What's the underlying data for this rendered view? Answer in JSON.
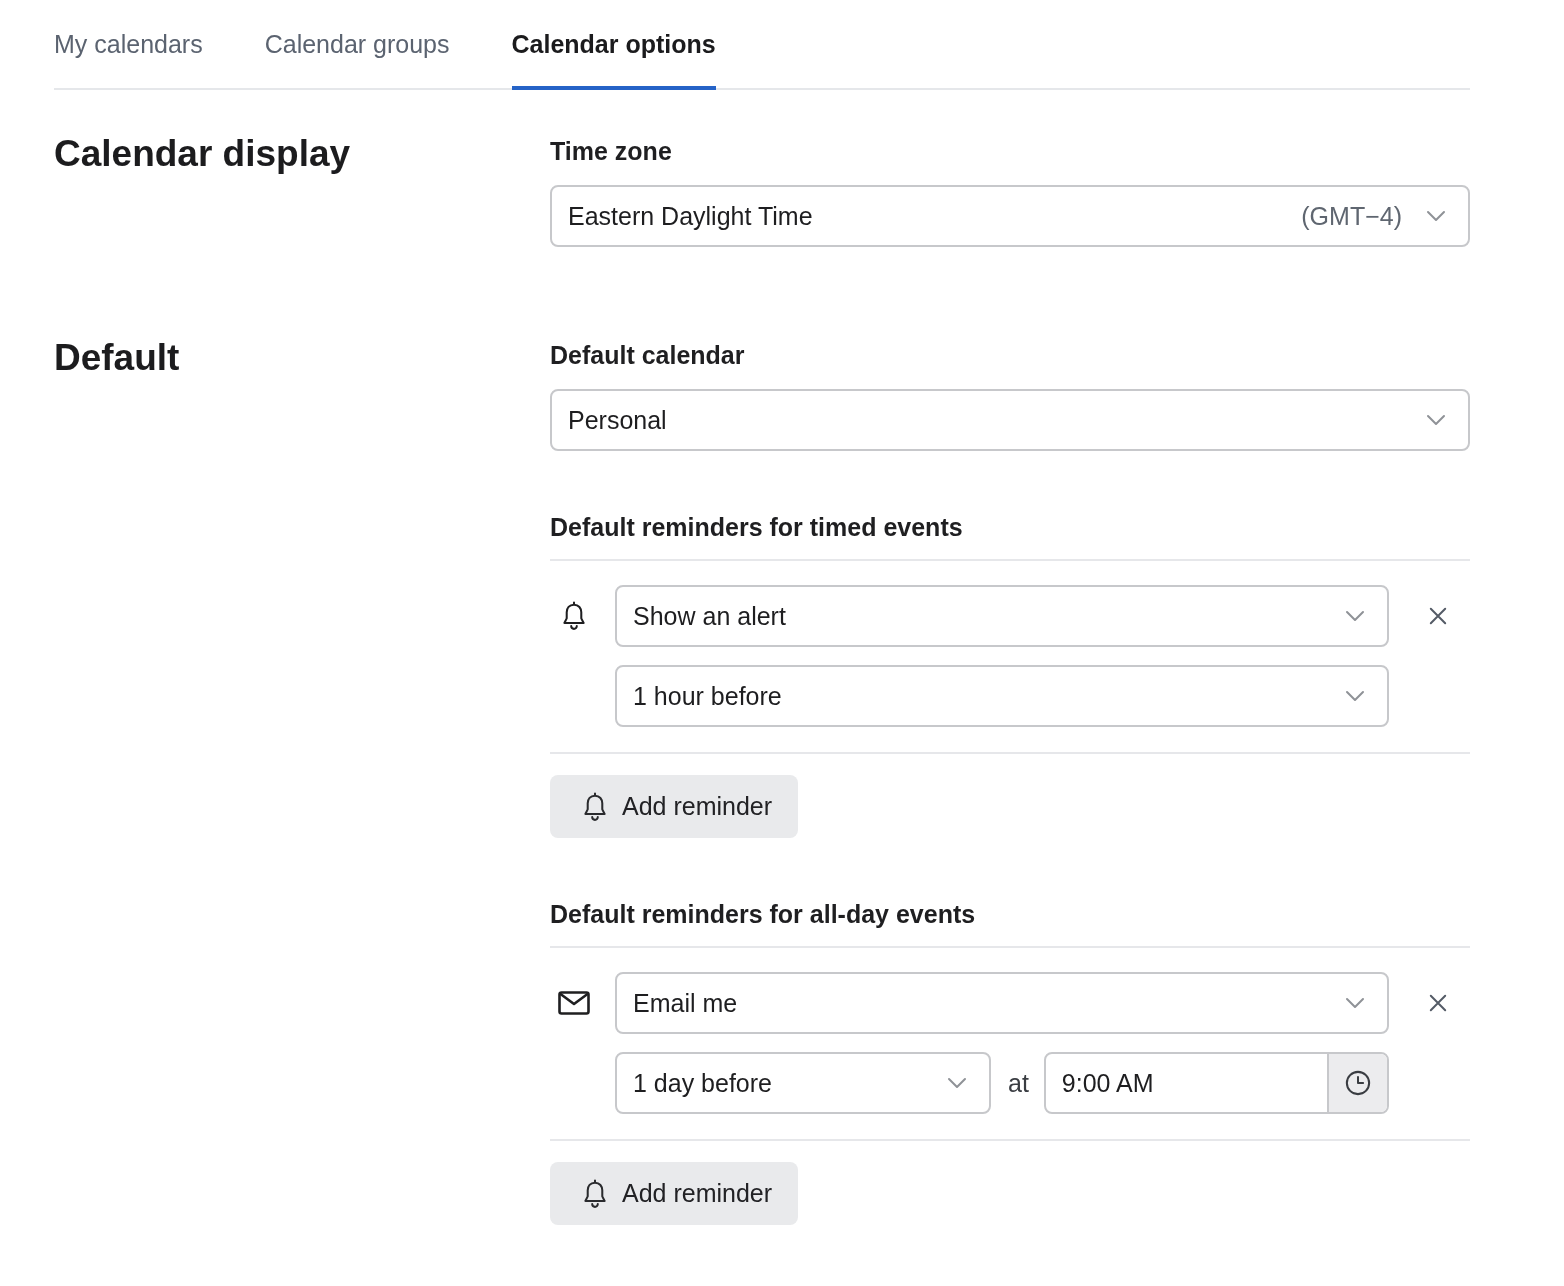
{
  "tabs": [
    {
      "label": "My calendars",
      "selected": false
    },
    {
      "label": "Calendar groups",
      "selected": false
    },
    {
      "label": "Calendar options",
      "selected": true
    }
  ],
  "sections": [
    {
      "heading": "Calendar display",
      "fields": [
        {
          "kind": "select",
          "label": "Time zone",
          "value": "Eastern Daylight Time",
          "suffix": "(GMT−4)"
        }
      ]
    },
    {
      "heading": "Default",
      "fields": [
        {
          "kind": "select",
          "label": "Default calendar",
          "value": "Personal"
        },
        {
          "kind": "reminders",
          "label": "Default reminders for timed events",
          "reminders": [
            {
              "kind": "alert",
              "method": "Show an alert",
              "timing": "1 hour before"
            }
          ],
          "add_button": "Add reminder"
        },
        {
          "kind": "reminders",
          "label": "Default reminders for all-day events",
          "reminders": [
            {
              "kind": "email",
              "method": "Email me",
              "timing": "1 day before",
              "at": "at",
              "time": "9:00 AM"
            }
          ],
          "add_button": "Add reminder"
        }
      ]
    }
  ]
}
